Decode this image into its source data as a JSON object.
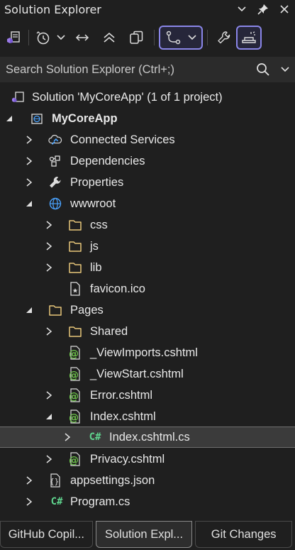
{
  "window": {
    "title": "Solution Explorer"
  },
  "search": {
    "placeholder": "Search Solution Explorer (Ctrl+;)"
  },
  "tree": {
    "solution": "Solution 'MyCoreApp' (1 of 1 project)",
    "project": "MyCoreApp",
    "connected_services": "Connected Services",
    "dependencies": "Dependencies",
    "properties": "Properties",
    "wwwroot": "wwwroot",
    "css": "css",
    "js": "js",
    "lib": "lib",
    "favicon": "favicon.ico",
    "pages": "Pages",
    "shared": "Shared",
    "viewimports": "_ViewImports.cshtml",
    "viewstart": "_ViewStart.cshtml",
    "error": "Error.cshtml",
    "index": "Index.cshtml",
    "index_cs": "Index.cshtml.cs",
    "privacy": "Privacy.cshtml",
    "appsettings": "appsettings.json",
    "program": "Program.cs"
  },
  "glyphs": {
    "csharp": "C#",
    "razor": "@",
    "json": "{}"
  },
  "tabs": {
    "github_copilot": "GitHub Copil...",
    "solution_explorer": "Solution Expl...",
    "git_changes": "Git Changes"
  },
  "colors": {
    "background": "#1f1f1f",
    "accent": "#8a86e8",
    "folder": "#e8c77a",
    "razor_green": "#6cc24a",
    "csharp_green": "#5fd38d",
    "globe_blue": "#4aa3ff"
  }
}
